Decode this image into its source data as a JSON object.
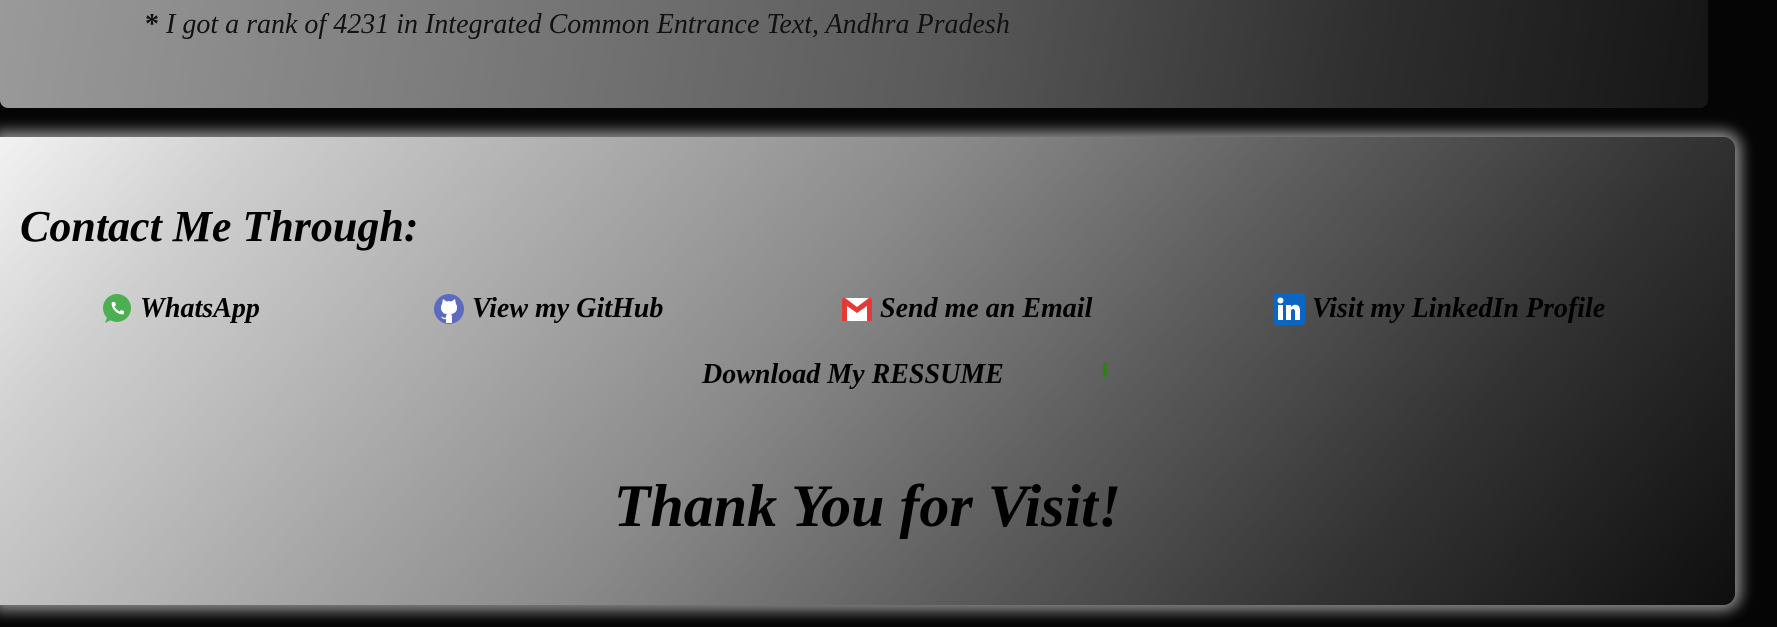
{
  "previous_section": {
    "rank_note_star": "*",
    "rank_note_text": "I got a rank of 4231 in Integrated Common Entrance Text, Andhra Pradesh"
  },
  "contact": {
    "heading": "Contact Me Through:",
    "links": [
      {
        "label": "WhatsApp",
        "icon": "whatsapp-icon",
        "color": "#4caf50"
      },
      {
        "label": "View my GitHub",
        "icon": "github-icon",
        "color": "#5c6bc0"
      },
      {
        "label": "Send me an Email",
        "icon": "gmail-icon",
        "color": "#e53935"
      },
      {
        "label": "Visit my LinkedIn Profile",
        "icon": "linkedin-icon",
        "color": "#0a66c2"
      }
    ],
    "resume_label": "Download My RESSUME"
  },
  "closing": {
    "thanks": "Thank You for Visit!"
  },
  "colors": {
    "page_background": "#050505",
    "progress_gradient_start": "#f0288c",
    "progress_gradient_end": "#fd9230",
    "text": "#000000"
  }
}
